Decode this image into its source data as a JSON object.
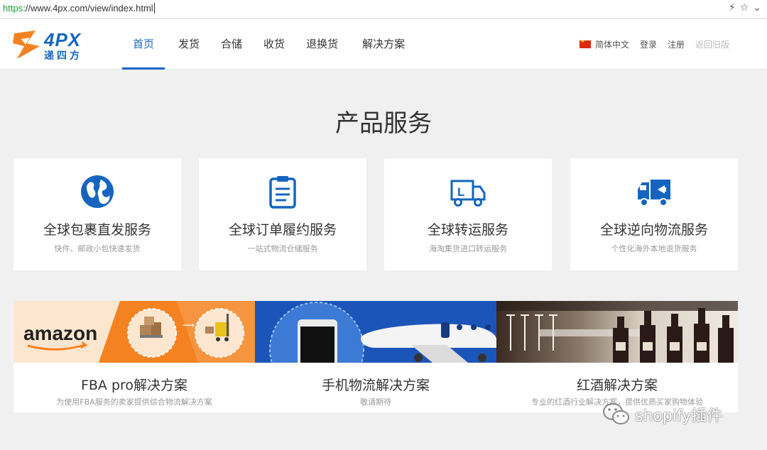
{
  "browser": {
    "scheme": "https",
    "url_rest": "://www.4px.com/view/index.html"
  },
  "brand": {
    "logo_text": "4PX",
    "logo_sub": "递四方",
    "primary_color": "#1565c0",
    "accent_color": "#f58220"
  },
  "nav": [
    {
      "label": "首页",
      "active": true
    },
    {
      "label": "发货"
    },
    {
      "label": "合储"
    },
    {
      "label": "收货"
    },
    {
      "label": "退换货"
    },
    {
      "label": "解决方案"
    }
  ],
  "header_links": {
    "language": "简体中文",
    "login": "登录",
    "register": "注册",
    "old_version": "返回旧版"
  },
  "section_title": "产品服务",
  "services": [
    {
      "icon": "globe-icon",
      "title": "全球包裹直发服务",
      "desc": "快件、邮政小包快速发货"
    },
    {
      "icon": "clipboard-icon",
      "title": "全球订单履约服务",
      "desc": "一站式物流仓储服务"
    },
    {
      "icon": "truck-icon",
      "title": "全球转运服务",
      "desc": "海淘集货进口转运服务"
    },
    {
      "icon": "return-truck-icon",
      "title": "全球逆向物流服务",
      "desc": "个性化海外本地退货服务"
    }
  ],
  "solutions": [
    {
      "image": "amazon-banner",
      "brand_text": "amazon",
      "title": "FBA pro解决方案",
      "desc": "为使用FBA服务的卖家提供综合物流解决方案"
    },
    {
      "image": "phone-plane-banner",
      "title": "手机物流解决方案",
      "desc": "敬请期待"
    },
    {
      "image": "wine-banner",
      "title": "红酒解决方案",
      "desc": "专业的红酒行业解决方案，提供优质买家购物体验"
    }
  ],
  "watermark": "shopify插件"
}
